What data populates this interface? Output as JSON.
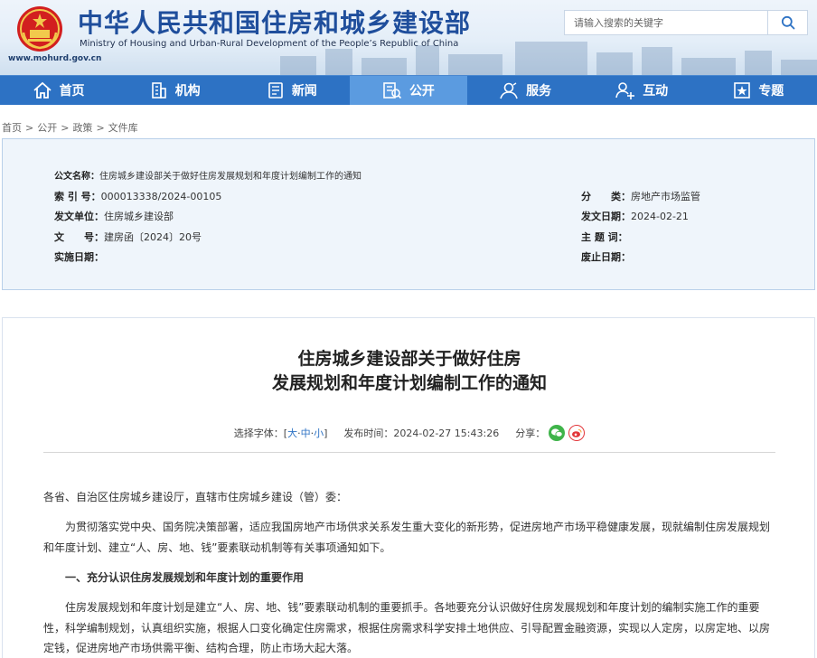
{
  "header": {
    "title_cn": "中华人民共和国住房和城乡建设部",
    "title_en": "Ministry of Housing and Urban-Rural Development of the People’s Republic of China",
    "site_url": "www.mohurd.gov.cn",
    "search_placeholder": "请输入搜索的关键字"
  },
  "nav": {
    "items": [
      {
        "label": "首页",
        "icon": "home-icon"
      },
      {
        "label": "机构",
        "icon": "building-icon"
      },
      {
        "label": "新闻",
        "icon": "news-icon"
      },
      {
        "label": "公开",
        "icon": "disclosure-icon",
        "active": true
      },
      {
        "label": "服务",
        "icon": "service-icon"
      },
      {
        "label": "互动",
        "icon": "interaction-icon"
      },
      {
        "label": "专题",
        "icon": "topic-icon"
      }
    ]
  },
  "breadcrumb": [
    "首页",
    "公开",
    "政策",
    "文件库"
  ],
  "meta": {
    "doc_name_label": "公文名称：",
    "doc_name": "住房城乡建设部关于做好住房发展规划和年度计划编制工作的通知",
    "index_label": "索 引 号：",
    "index": "000013338/2024-00105",
    "category_label": "分　　类：",
    "category": "房地产市场监管",
    "issuer_label": "发文单位：",
    "issuer": "住房城乡建设部",
    "issue_date_label": "发文日期：",
    "issue_date": "2024-02-21",
    "doc_no_label": "文　　号：",
    "doc_no": "建房函〔2024〕20号",
    "subject_label": "主 题 词：",
    "subject": "",
    "effective_label": "实施日期：",
    "effective": "",
    "expiry_label": "废止日期：",
    "expiry": ""
  },
  "article": {
    "title_line1": "住房城乡建设部关于做好住房",
    "title_line2": "发展规划和年度计划编制工作的通知",
    "font_select_label": "选择字体：[",
    "font_large": "大",
    "font_medium": "中",
    "font_small": "小",
    "font_close": "]",
    "publish_label": "发布时间：",
    "publish_time": "2024-02-27 15:43:26",
    "share_label": "分享：",
    "salutation": "各省、自治区住房城乡建设厅，直辖市住房城乡建设（管）委：",
    "para1": "为贯彻落实党中央、国务院决策部署，适应我国房地产市场供求关系发生重大变化的新形势，促进房地产市场平稳健康发展，现就编制住房发展规划和年度计划、建立“人、房、地、钱”要素联动机制等有关事项通知如下。",
    "heading1": "一、充分认识住房发展规划和年度计划的重要作用",
    "para2": "住房发展规划和年度计划是建立“人、房、地、钱”要素联动机制的重要抓手。各地要充分认识做好住房发展规划和年度计划的编制实施工作的重要性，科学编制规划，认真组织实施，根据人口变化确定住房需求，根据住房需求科学安排土地供应、引导配置金融资源，实现以人定房，以房定地、以房定钱，促进房地产市场供需平衡、结构合理，防止市场大起大落。"
  },
  "colors": {
    "nav_bg": "#2d72c4",
    "nav_active": "#5b9be0",
    "title_blue": "#1f4e9c",
    "meta_bg": "#eff5fb"
  }
}
